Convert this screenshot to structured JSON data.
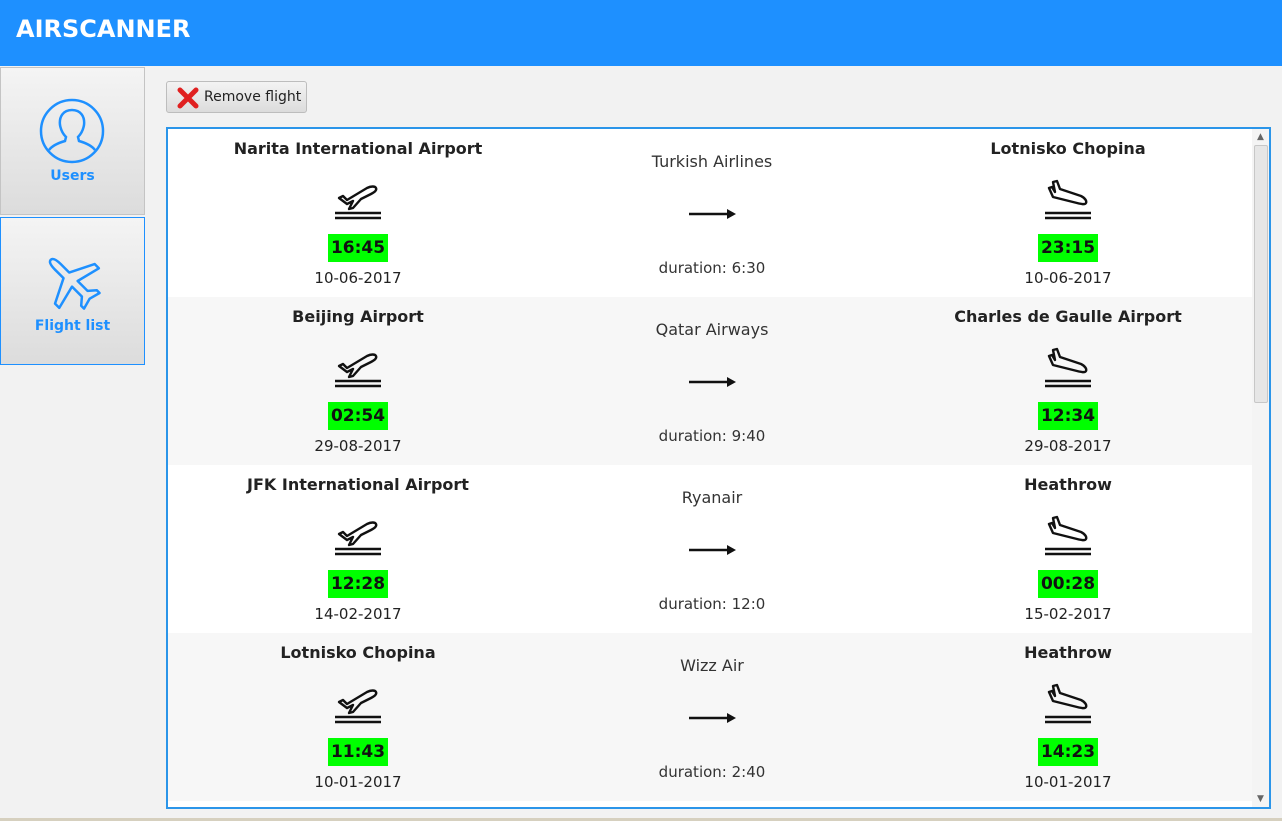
{
  "app": {
    "title": "AIRSCANNER"
  },
  "nav": {
    "users_label": "Users",
    "flights_label": "Flight list",
    "accent_color": "#1e90ff"
  },
  "toolbar": {
    "remove_label": "Remove flight"
  },
  "flights": [
    {
      "departure": {
        "airport": "Narita International Airport",
        "time": "16:45",
        "date": "10-06-2017"
      },
      "airline": "Turkish Airlines",
      "duration": "duration: 6:30",
      "arrival": {
        "airport": "Lotnisko Chopina",
        "time": "23:15",
        "date": "10-06-2017"
      }
    },
    {
      "departure": {
        "airport": "Beijing Airport",
        "time": "02:54",
        "date": "29-08-2017"
      },
      "airline": "Qatar Airways",
      "duration": "duration: 9:40",
      "arrival": {
        "airport": "Charles de Gaulle Airport",
        "time": "12:34",
        "date": "29-08-2017"
      }
    },
    {
      "departure": {
        "airport": "JFK International Airport",
        "time": "12:28",
        "date": "14-02-2017"
      },
      "airline": "Ryanair",
      "duration": "duration: 12:0",
      "arrival": {
        "airport": "Heathrow",
        "time": "00:28",
        "date": "15-02-2017"
      }
    },
    {
      "departure": {
        "airport": "Lotnisko Chopina",
        "time": "11:43",
        "date": "10-01-2017"
      },
      "airline": "Wizz Air",
      "duration": "duration: 2:40",
      "arrival": {
        "airport": "Heathrow",
        "time": "14:23",
        "date": "10-01-2017"
      }
    }
  ],
  "icons": {
    "users": "user-icon",
    "flights": "airplane-icon",
    "remove": "red-x-icon",
    "departure": "plane-takeoff-icon",
    "arrival": "plane-landing-icon",
    "direction": "arrow-right-icon"
  },
  "colors": {
    "header": "#1e90ff",
    "time_badge": "#00ff00",
    "list_border": "#2b95e9",
    "remove_icon": "#e02020"
  }
}
